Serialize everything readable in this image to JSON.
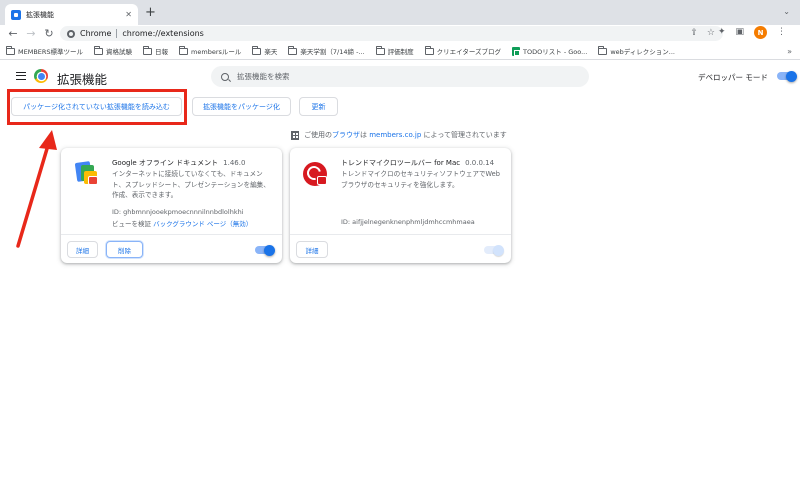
{
  "tab": {
    "title": "拡張機能",
    "close": "✕"
  },
  "toolbar": {
    "back": "←",
    "forward": "→",
    "reload": "↻",
    "omnibox_label": "Chrome",
    "url": "chrome://extensions",
    "avatar_letter": "N"
  },
  "bookmarks": [
    {
      "label": "MEMBERS標準ツール",
      "icon": "folder-icon"
    },
    {
      "label": "資格試験",
      "icon": "folder-icon"
    },
    {
      "label": "日報",
      "icon": "folder-icon"
    },
    {
      "label": "membersルール",
      "icon": "folder-icon"
    },
    {
      "label": "楽天",
      "icon": "folder-icon"
    },
    {
      "label": "楽天学割（7/14締 -...",
      "icon": "folder-icon"
    },
    {
      "label": "評価制度",
      "icon": "folder-icon"
    },
    {
      "label": "クリエイターズブログ",
      "icon": "folder-icon"
    },
    {
      "label": "TODOリスト - Goo...",
      "icon": "sheets-icon"
    },
    {
      "label": "webディレクション...",
      "icon": "folder-icon"
    }
  ],
  "header": {
    "title": "拡張機能",
    "search_placeholder": "拡張機能を検索",
    "dev_mode_label": "デベロッパー モード",
    "dev_mode_on": true
  },
  "actions": {
    "load_unpacked": "パッケージ化されていない拡張機能を読み込む",
    "pack": "拡張機能をパッケージ化",
    "update": "更新"
  },
  "managed_notice": {
    "prefix": "ご使用の",
    "browser_link": "ブラウザ",
    "middle": "は ",
    "domain": "members.co.jp",
    "suffix": " によって管理されています"
  },
  "extensions": [
    {
      "name": "Google オフライン ドキュメント",
      "version": "1.46.0",
      "description": "インターネットに接続していなくても、ドキュメント、スプレッドシート、プレゼンテーションを編集、作成、表示できます。",
      "id": "ID: ghbmnnjooekpmoecnnnilnnbdlolhkhi",
      "inspect_label": "ビューを検証",
      "inspect_link": "バックグラウンド ページ（無効）",
      "details": "詳細",
      "remove": "削除",
      "enabled": true,
      "icon": "google-docs-offline-icon"
    },
    {
      "name": "トレンドマイクロツールバー for Mac",
      "version": "0.0.0.14",
      "description": "トレンドマイクロのセキュリティソフトウェアでWebブラウザのセキュリティを強化します。",
      "id": "ID: aifjjelnegenknenphmljdmhccmhmaea",
      "details": "詳細",
      "enabled": true,
      "policy_locked": true,
      "icon": "trend-micro-icon"
    }
  ],
  "colors": {
    "accent": "#1a73e8",
    "highlight": "#e8281a",
    "tab_strip": "#dee1e6"
  }
}
